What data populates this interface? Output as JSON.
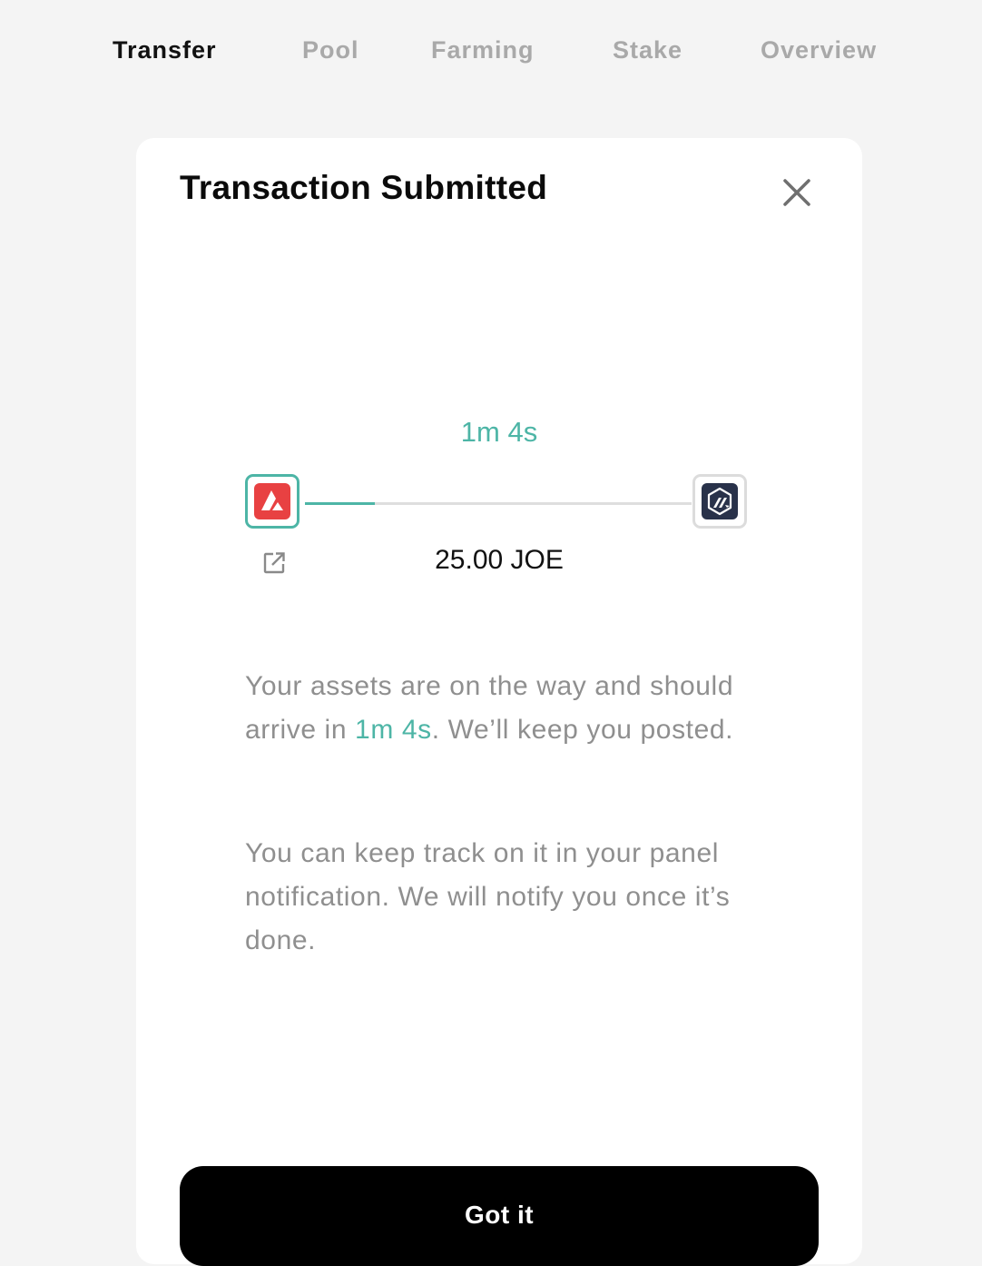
{
  "nav": {
    "tabs": [
      {
        "label": "Transfer",
        "active": true
      },
      {
        "label": "Pool",
        "active": false
      },
      {
        "label": "Farming",
        "active": false
      },
      {
        "label": "Stake",
        "active": false
      },
      {
        "label": "Overview",
        "active": false
      }
    ]
  },
  "modal": {
    "title": "Transaction Submitted",
    "close_icon": "close-icon",
    "eta": "1m 4s",
    "progress_fraction": 0.18,
    "amount": "25.00 JOE",
    "from_chain_icon": "avalanche-logo-icon",
    "to_chain_icon": "arbitrum-logo-icon",
    "external_link_icon": "external-link-icon",
    "message1": {
      "before": "Your assets are on the way and should arrive in ",
      "highlight": "1m 4s",
      "after": ". We’ll keep you posted."
    },
    "message2": "You can keep track on it in your panel notification. We will notify you once it’s done.",
    "button_label": "Got it"
  },
  "colors": {
    "accent": "#4db5a6",
    "avalanche_red": "#e84142",
    "arbitrum_navy": "#29324a",
    "button_black": "#000000"
  }
}
